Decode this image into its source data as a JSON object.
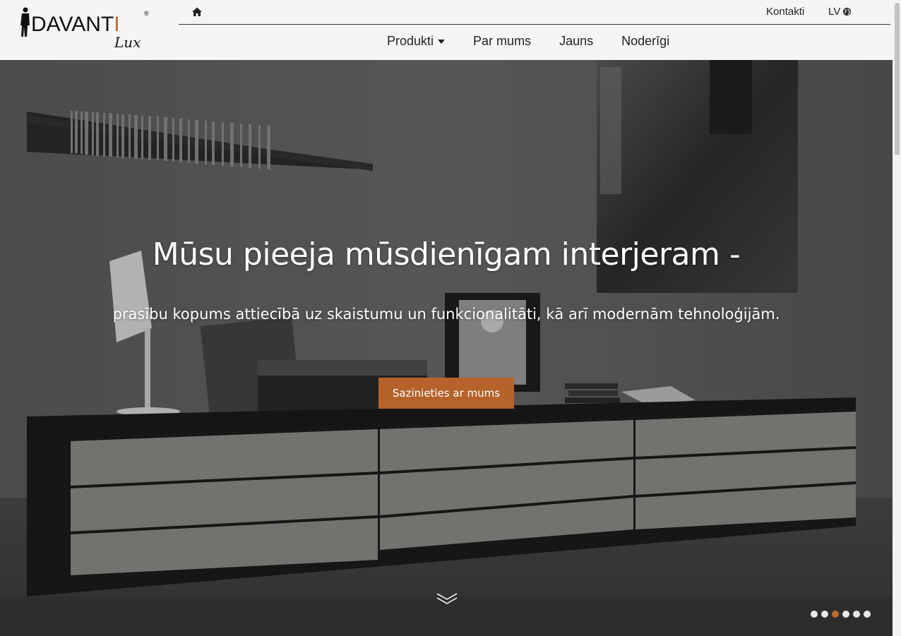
{
  "header": {
    "logo": {
      "brand_main": "DAVANT",
      "brand_accent": "I",
      "registered": "®",
      "script": "Lux"
    },
    "top_links": {
      "contacts": "Kontakti",
      "language": "LV"
    },
    "nav": {
      "products": "Produkti",
      "about": "Par mums",
      "news": "Jauns",
      "useful": "Noderīgi"
    }
  },
  "hero": {
    "title": "Mūsu pieeja mūsdienīgam interjeram -",
    "subtitle": "prasību kopums attiecībā uz skaistumu un funkcionalitāti, kā arī modernām tehnoloģijām.",
    "cta_label": "Sazinieties ar mums",
    "slides": {
      "count": 6,
      "active": 2
    }
  },
  "icons": {
    "home": "home-icon",
    "globe": "globe-icon",
    "caret": "caret-down-icon",
    "scroll": "double-chevron-down-icon"
  },
  "colors": {
    "accent": "#c0692c",
    "button": "#b5632a",
    "header_bg": "#f5f5f5"
  }
}
